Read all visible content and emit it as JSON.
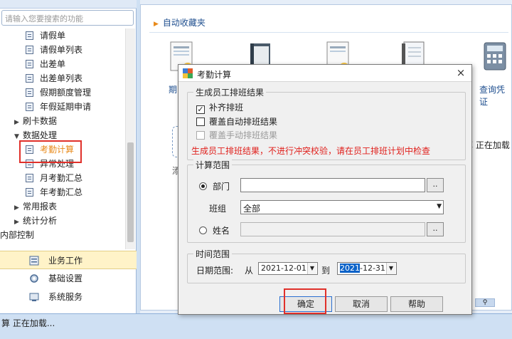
{
  "left_panel": {
    "search_placeholder": "请输入您要搜索的功能",
    "tree": [
      {
        "label": "请假单",
        "type": "doc",
        "indent": 2
      },
      {
        "label": "请假单列表",
        "type": "doc",
        "indent": 2
      },
      {
        "label": "出差单",
        "type": "doc",
        "indent": 2
      },
      {
        "label": "出差单列表",
        "type": "doc",
        "indent": 2
      },
      {
        "label": "假期额度管理",
        "type": "doc",
        "indent": 2
      },
      {
        "label": "年假延期申请",
        "type": "doc",
        "indent": 2
      },
      {
        "label": "刷卡数据",
        "type": "folder",
        "indent": 1,
        "expanded": false
      },
      {
        "label": "数据处理",
        "type": "folder",
        "indent": 1,
        "expanded": true
      },
      {
        "label": "考勤计算",
        "type": "doc",
        "indent": 2,
        "selected": true
      },
      {
        "label": "异常处理",
        "type": "doc",
        "indent": 2
      },
      {
        "label": "月考勤汇总",
        "type": "doc",
        "indent": 2
      },
      {
        "label": "年考勤汇总",
        "type": "doc",
        "indent": 2
      },
      {
        "label": "常用报表",
        "type": "folder",
        "indent": 1,
        "expanded": false
      },
      {
        "label": "统计分析",
        "type": "folder",
        "indent": 1,
        "expanded": false
      },
      {
        "label": "内部控制",
        "type": "root",
        "indent": 0
      }
    ],
    "bottom_nav": [
      {
        "label": "业务工作",
        "active": true,
        "icon": "business-icon"
      },
      {
        "label": "基础设置",
        "active": false,
        "icon": "gear-icon"
      },
      {
        "label": "系统服务",
        "active": false,
        "icon": "service-icon"
      }
    ],
    "selected_color": "#e88a1a"
  },
  "main": {
    "favorites_title": "自动收藏夹",
    "favorites": [
      {
        "label": "期",
        "icon": "document-icon"
      },
      {
        "label": "",
        "icon": "book-icon"
      },
      {
        "label": "",
        "icon": "document-icon"
      },
      {
        "label": "",
        "icon": "notebook-icon"
      },
      {
        "label": "查询凭证",
        "icon": "calculator-icon"
      }
    ],
    "add_label": "添",
    "right_text": "算 正在加载"
  },
  "status_bar": {
    "text": "算 正在加载..."
  },
  "dialog": {
    "title": "考勤计算",
    "close": "×",
    "group1": {
      "legend": "生成员工排班结果",
      "options": [
        {
          "label": "补齐排班",
          "checked": true,
          "disabled": false
        },
        {
          "label": "覆盖自动排班结果",
          "checked": false,
          "disabled": false
        },
        {
          "label": "覆盖手动排班结果",
          "checked": false,
          "disabled": true
        }
      ],
      "warning": "生成员工排班结果，不进行冲突校验，请在员工排班计划中检查"
    },
    "group2": {
      "legend": "计算范围",
      "dept_label": "部门",
      "dept_value": "",
      "team_label": "班组",
      "team_value": "全部",
      "name_label": "姓名",
      "name_value": "",
      "browse": "..",
      "selected_scope": "部门"
    },
    "group3": {
      "legend": "时间范围",
      "range_label": "日期范围:",
      "from_label": "从",
      "from_value": "2021-12-01",
      "to_label": "到",
      "to_value_year": "2021",
      "to_value_rest": "-12-31"
    },
    "buttons": {
      "ok": "确定",
      "cancel": "取消",
      "help": "帮助"
    },
    "accent": "#e0302a"
  }
}
